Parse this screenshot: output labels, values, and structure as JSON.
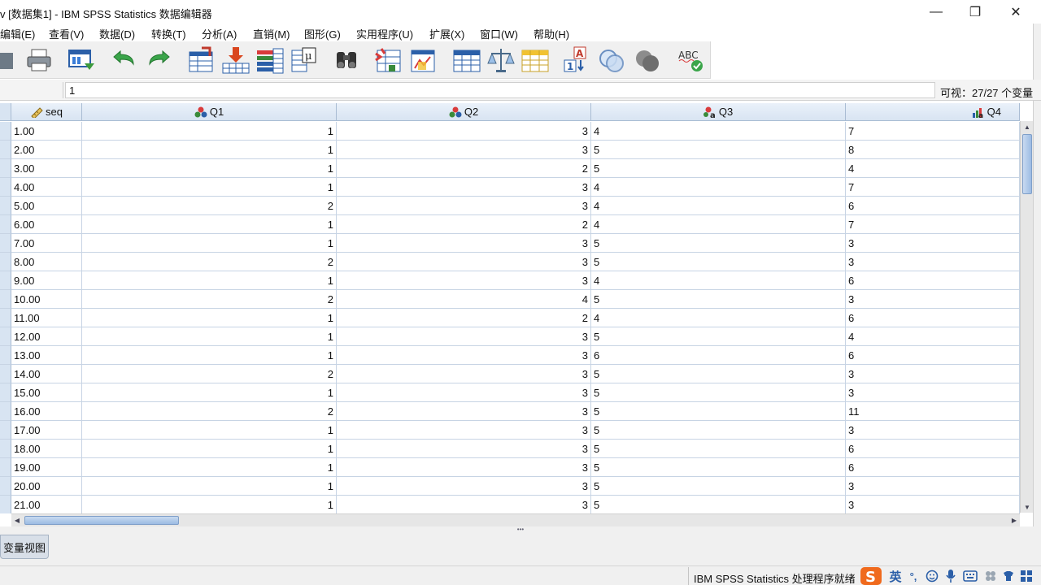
{
  "window": {
    "title": "v [数据集1] - IBM SPSS Statistics 数据编辑器",
    "minimize": "—",
    "maximize": "❐",
    "close": "✕"
  },
  "menu": [
    {
      "label": "编辑(E)"
    },
    {
      "label": "查看(V)"
    },
    {
      "label": "数据(D)"
    },
    {
      "label": "转换(T)"
    },
    {
      "label": "分析(A)"
    },
    {
      "label": "直销(M)"
    },
    {
      "label": "图形(G)"
    },
    {
      "label": "实用程序(U)"
    },
    {
      "label": "扩展(X)"
    },
    {
      "label": "窗口(W)"
    },
    {
      "label": "帮助(H)"
    }
  ],
  "toolbar": {
    "icons": [
      "save-icon",
      "print-icon",
      "dialog-recall-icon",
      "undo-icon",
      "redo-icon",
      "goto-case-icon",
      "goto-variable-icon",
      "variables-icon",
      "run-descriptive-icon",
      "find-icon",
      "insert-cases-icon",
      "insert-variable-icon",
      "split-file-icon",
      "weight-cases-icon",
      "select-cases-icon",
      "value-labels-icon",
      "use-sets-icon",
      "show-all-variables-icon",
      "spell-check-icon"
    ]
  },
  "editor": {
    "cell_value": "1",
    "visible_vars": "可视：27/27 个变量"
  },
  "grid": {
    "columns": [
      {
        "name": "seq",
        "icon": "scale-ruler-icon"
      },
      {
        "name": "Q1",
        "icon": "nominal-icon"
      },
      {
        "name": "Q2",
        "icon": "nominal-icon"
      },
      {
        "name": "Q3",
        "icon": "nominal-string-icon"
      },
      {
        "name": "Q4",
        "icon": "ordinal-string-icon"
      }
    ],
    "rows": [
      [
        "1.00",
        "1",
        "3",
        "4",
        "7"
      ],
      [
        "2.00",
        "1",
        "3",
        "5",
        "8"
      ],
      [
        "3.00",
        "1",
        "2",
        "5",
        "4"
      ],
      [
        "4.00",
        "1",
        "3",
        "4",
        "7"
      ],
      [
        "5.00",
        "2",
        "3",
        "4",
        "6"
      ],
      [
        "6.00",
        "1",
        "2",
        "4",
        "7"
      ],
      [
        "7.00",
        "1",
        "3",
        "5",
        "3"
      ],
      [
        "8.00",
        "2",
        "3",
        "5",
        "3"
      ],
      [
        "9.00",
        "1",
        "3",
        "4",
        "6"
      ],
      [
        "10.00",
        "2",
        "4",
        "5",
        "3"
      ],
      [
        "11.00",
        "1",
        "2",
        "4",
        "6"
      ],
      [
        "12.00",
        "1",
        "3",
        "5",
        "4"
      ],
      [
        "13.00",
        "1",
        "3",
        "6",
        "6"
      ],
      [
        "14.00",
        "2",
        "3",
        "5",
        "3"
      ],
      [
        "15.00",
        "1",
        "3",
        "5",
        "3"
      ],
      [
        "16.00",
        "2",
        "3",
        "5",
        "11"
      ],
      [
        "17.00",
        "1",
        "3",
        "5",
        "3"
      ],
      [
        "18.00",
        "1",
        "3",
        "5",
        "6"
      ],
      [
        "19.00",
        "1",
        "3",
        "5",
        "6"
      ],
      [
        "20.00",
        "1",
        "3",
        "5",
        "3"
      ],
      [
        "21.00",
        "1",
        "3",
        "5",
        "3"
      ]
    ]
  },
  "tabs": {
    "variable_view": "变量视图"
  },
  "status": {
    "text": "IBM SPSS Statistics 处理程序就绪",
    "ime_lang": "英",
    "ime_icons": [
      "sogou-logo-icon",
      "punctuation-icon",
      "emoji-icon",
      "microphone-icon",
      "keyboard-icon",
      "tools-icon",
      "skin-icon",
      "grid-menu-icon"
    ]
  },
  "colors": {
    "header_bg": "#d8e4f2",
    "gridline": "#c7d4e4",
    "scroll_thumb": "#9cbbe3",
    "sogou_orange": "#f06a1d"
  }
}
